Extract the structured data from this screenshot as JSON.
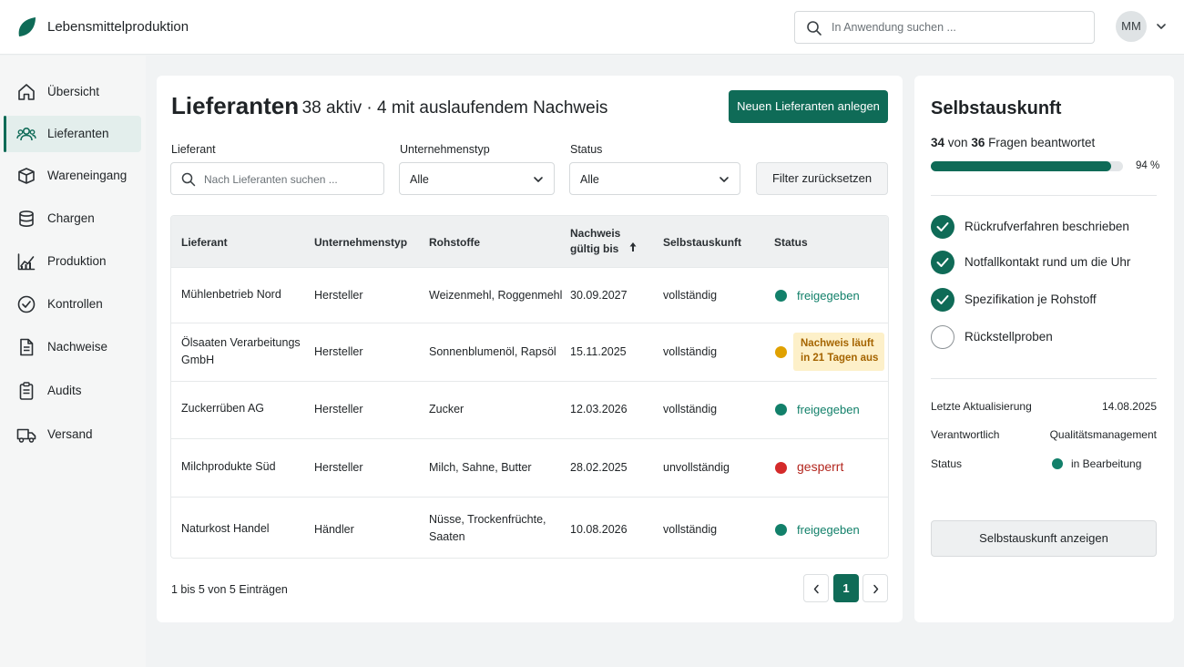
{
  "app": {
    "name": "Lebensmittelproduktion"
  },
  "header": {
    "search_placeholder": "In Anwendung suchen ...",
    "user_initials": "MM"
  },
  "sidebar": {
    "items": [
      {
        "label": "Übersicht",
        "icon": "home-icon",
        "active": false
      },
      {
        "label": "Lieferanten",
        "icon": "users-icon",
        "active": true
      },
      {
        "label": "Wareneingang",
        "icon": "box-icon",
        "active": false
      },
      {
        "label": "Chargen",
        "icon": "database-icon",
        "active": false
      },
      {
        "label": "Produktion",
        "icon": "chart-icon",
        "active": false
      },
      {
        "label": "Kontrollen",
        "icon": "check-circle-icon",
        "active": false
      },
      {
        "label": "Nachweise",
        "icon": "document-icon",
        "active": false
      },
      {
        "label": "Audits",
        "icon": "clipboard-icon",
        "active": false
      },
      {
        "label": "Versand",
        "icon": "truck-icon",
        "active": false
      }
    ]
  },
  "main": {
    "title": "Lieferanten",
    "subtitle": "· 38 aktiv · 4 mit auslaufendem Nachweis",
    "new_button": "Neuen Lieferanten anlegen",
    "filters": {
      "supplier_label": "Lieferant",
      "supplier_placeholder": "Nach Lieferanten suchen ...",
      "type_label": "Unternehmenstyp",
      "type_value": "Alle",
      "status_label": "Status",
      "status_value": "Alle",
      "reset_button": "Filter zurücksetzen"
    },
    "table": {
      "headers": [
        "Lieferant",
        "Unternehmenstyp",
        "Rohstoffe",
        "Nachweis gültig bis",
        "Selbstauskunft",
        "Status"
      ],
      "header_nachweis_line1": "Nachweis",
      "header_nachweis_line2": "gültig bis",
      "rows": [
        {
          "name1": "Mühlenbetrieb Nord",
          "name2": "",
          "type": "Hersteller",
          "raw1": "Weizenmehl, Roggenmehl",
          "raw2": "",
          "valid": "30.09.2027",
          "self": "vollständig",
          "status": "freigegeben",
          "status_kind": "ok"
        },
        {
          "name1": "Ölsaaten Verarbeitungs",
          "name2": "GmbH",
          "type": "Hersteller",
          "raw1": "Sonnenblumenöl, Rapsöl",
          "raw2": "",
          "valid": "15.11.2025",
          "self": "vollständig",
          "status": "Nachweis läuft in 21 Tagen aus",
          "status_line1": "Nachweis läuft",
          "status_line2": "in 21 Tagen aus",
          "status_kind": "warn"
        },
        {
          "name1": "Zuckerrüben AG",
          "name2": "",
          "type": "Hersteller",
          "raw1": "Zucker",
          "raw2": "",
          "valid": "12.03.2026",
          "self": "vollständig",
          "status": "freigegeben",
          "status_kind": "ok"
        },
        {
          "name1": "Milchprodukte Süd",
          "name2": "",
          "type": "Hersteller",
          "raw1": "Milch, Sahne, Butter",
          "raw2": "",
          "valid": "28.02.2025",
          "self": "unvollständig",
          "status": "gesperrt",
          "status_kind": "blocked"
        },
        {
          "name1": "Naturkost Handel",
          "name2": "",
          "type": "Händler",
          "raw1": "Nüsse, Trockenfrüchte,",
          "raw2": "Saaten",
          "valid": "10.08.2026",
          "self": "vollständig",
          "status": "freigegeben",
          "status_kind": "ok"
        }
      ]
    },
    "pagination": {
      "info": "1 bis 5 von 5 Einträgen",
      "current_page": "1"
    }
  },
  "panel": {
    "title": "Selbstauskunft",
    "answered": "34",
    "total": "36",
    "answered_suffix": "Fragen beantwortet",
    "von": "von",
    "progress_fraction": 0.94,
    "progress_label": "94 %",
    "checklist": [
      {
        "label": "Rückrufverfahren beschrieben",
        "done": true
      },
      {
        "label": "Notfallkontakt rund um die Uhr",
        "done": true
      },
      {
        "label": "Spezifikation je Rohstoff",
        "done": true
      },
      {
        "label": "Rückstellproben",
        "done": false
      }
    ],
    "meta": {
      "updated_label": "Letzte Aktualisierung",
      "updated_value": "14.08.2025",
      "responsible_label": "Verantwortlich",
      "responsible_value": "Qualitätsmanagement",
      "status_label": "Status",
      "status_value": "in Bearbeitung"
    },
    "button": "Selbstauskunft anzeigen"
  },
  "colors": {
    "accent": "#0f6b57",
    "ok": "#12806a",
    "warn_dot": "#e0a100",
    "blocked": "#d42a2a",
    "blocked_text": "#b3261e"
  }
}
